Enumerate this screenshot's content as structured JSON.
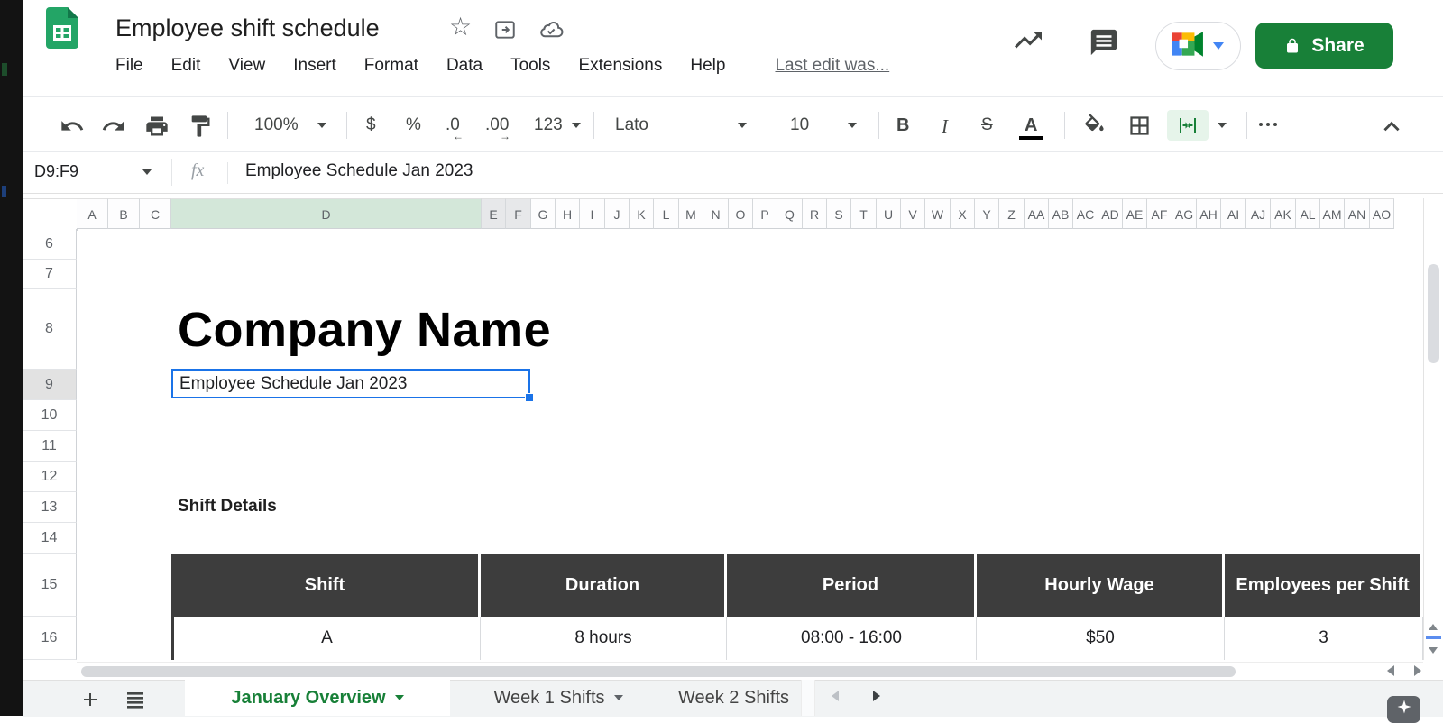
{
  "header": {
    "title": "Employee shift schedule",
    "menu": [
      "File",
      "Edit",
      "View",
      "Insert",
      "Format",
      "Data",
      "Tools",
      "Extensions",
      "Help"
    ],
    "last_edit": "Last edit was...",
    "share_label": "Share"
  },
  "toolbar": {
    "zoom": "100%",
    "currency": "$",
    "percent": "%",
    "decimal_decrease": ".0",
    "decimal_increase": ".00",
    "number_format": "123",
    "font_name": "Lato",
    "font_size": "10",
    "bold": "B",
    "italic": "I",
    "strikethrough": "S",
    "text_color": "A"
  },
  "formula_bar": {
    "name_box": "D9:F9",
    "fx": "fx",
    "value": "Employee Schedule Jan 2023"
  },
  "grid": {
    "column_letters": [
      "A",
      "B",
      "C",
      "D",
      "E",
      "F",
      "G",
      "H",
      "I",
      "J",
      "K",
      "L",
      "M",
      "N",
      "O",
      "P",
      "Q",
      "R",
      "S",
      "T",
      "U",
      "V",
      "W",
      "X",
      "Y",
      "Z",
      "AA",
      "AB",
      "AC",
      "AD",
      "AE",
      "AF",
      "AG",
      "AH",
      "AI",
      "AJ",
      "AK",
      "AL",
      "AM",
      "AN",
      "AO"
    ],
    "highlight": {
      "green": [
        "D"
      ],
      "gray": [
        "E",
        "F"
      ]
    },
    "row_numbers": [
      6,
      7,
      8,
      9,
      10,
      11,
      12,
      13,
      14,
      15,
      16
    ],
    "selected_row": 9,
    "selected_range": "D9:F9"
  },
  "canvas": {
    "company_name": "Company Name",
    "selected_cell_text": "Employee Schedule Jan 2023",
    "section_title": "Shift Details"
  },
  "table": {
    "headers": [
      "Shift",
      "Duration",
      "Period",
      "Hourly Wage",
      "Employees per Shift"
    ],
    "rows": [
      [
        "A",
        "8 hours",
        "08:00 - 16:00",
        "$50",
        "3"
      ]
    ]
  },
  "sheet_tabs": [
    {
      "label": "January Overview",
      "active": true
    },
    {
      "label": "Week 1 Shifts",
      "active": false
    },
    {
      "label": "Week 2 Shifts",
      "active": false
    }
  ],
  "colors": {
    "accent_green": "#188038",
    "selection_blue": "#1a73e8",
    "table_header_bg": "#3d3d3d",
    "column_highlight_green": "#d3e7d9",
    "tab_bar_bg": "#f1f3f4"
  }
}
